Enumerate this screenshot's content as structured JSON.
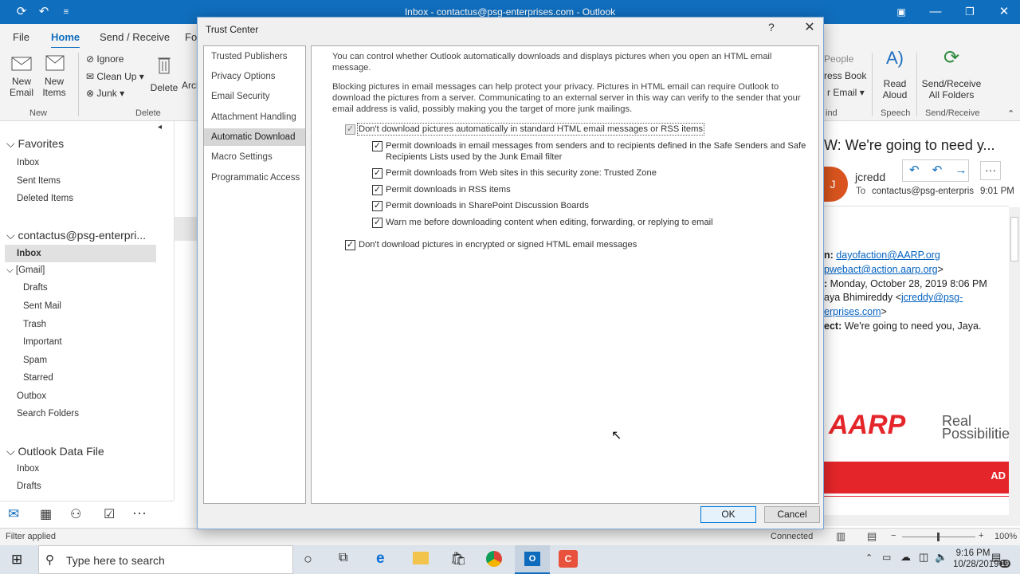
{
  "window": {
    "title": "Inbox - contactus@psg-enterprises.com  -  Outlook"
  },
  "ribbon": {
    "tabs": [
      "File",
      "Home",
      "Send / Receive",
      "Fo"
    ],
    "new_email": "New\nEmail",
    "new_email_l1": "New",
    "new_email_l2": "Email",
    "new_items_l1": "New",
    "new_items_l2": "Items",
    "ignore": "Ignore",
    "clean_up": "Clean Up",
    "junk": "Junk",
    "delete": "Delete",
    "archive": "Arch",
    "group_new": "New",
    "group_delete": "Delete",
    "people": "People",
    "address_book": "ress Book",
    "filter_email": "r Email",
    "group_find": "ind",
    "read_aloud_l1": "Read",
    "read_aloud_l2": "Aloud",
    "group_speech": "Speech",
    "send_receive_l1": "Send/Receive",
    "send_receive_l2": "All Folders",
    "group_send_receive": "Send/Receive"
  },
  "nav": {
    "favorites": "Favorites",
    "fav_items": [
      "Inbox",
      "Sent Items",
      "Deleted Items"
    ],
    "account": "contactus@psg-enterpri...",
    "inbox": "Inbox",
    "gmail": "[Gmail]",
    "gmail_items": [
      "Drafts",
      "Sent Mail",
      "Trash",
      "Important",
      "Spam",
      "Starred"
    ],
    "outbox": "Outbox",
    "search_folders": "Search Folders",
    "data_file": "Outlook Data File",
    "data_items": [
      "Inbox",
      "Drafts"
    ]
  },
  "status": {
    "left": "Filter applied",
    "connected": "Connected",
    "zoom": "100%"
  },
  "reading": {
    "subject": "W: We're going to need y...",
    "avatar_letter": "J",
    "sender": "jcredd",
    "to_label": "To",
    "to_value": "contactus@psg-enterpris",
    "time": "9:01 PM",
    "from_label": "n:",
    "from_value": "dayofaction@AARP.org",
    "reply_value": "pwebact@action.aarp.org",
    "sent_label": ":",
    "sent_value": "Monday, October 28, 2019 8:06 PM",
    "to2_prefix": "aya Bhimireddy <",
    "to2_link": "jcreddy@psg-",
    "to2_link2": "erprises.com",
    "subj_label": "ect:",
    "subj_value": "We're going to need you, Jaya.",
    "aarp": "AARP",
    "aarp_tag1": "Real",
    "aarp_tag2": "Possibilitie",
    "banner_text": "AD"
  },
  "dialog": {
    "title": "Trust Center",
    "help": "?",
    "nav": [
      "Trusted Publishers",
      "Privacy Options",
      "Email Security",
      "Attachment Handling",
      "Automatic Download",
      "Macro Settings",
      "Programmatic Access"
    ],
    "selected": "Automatic Download",
    "intro1": "You can control whether Outlook automatically downloads and displays pictures when you open an HTML email message.",
    "intro2": "Blocking pictures in email messages can help protect your privacy. Pictures in HTML email can require Outlook to download the pictures from a server. Communicating to an external server in this way can verify to the sender that your email address is valid, possibly making you the target of more junk mailings.",
    "opt_main": "Don't download pictures automatically in standard HTML email messages or RSS items",
    "opt_safe_senders": "Permit downloads in email messages from senders and to recipients defined in the Safe Senders and Safe Recipients Lists used by the Junk Email filter",
    "opt_trusted_zone": "Permit downloads from Web sites in this security zone: Trusted Zone",
    "opt_rss": "Permit downloads in RSS items",
    "opt_sharepoint": "Permit downloads in SharePoint Discussion Boards",
    "opt_warn": "Warn me before downloading content when editing, forwarding, or replying to email",
    "opt_encrypted": "Don't download pictures in encrypted or signed HTML email messages",
    "ok": "OK",
    "cancel": "Cancel"
  },
  "taskbar": {
    "search_placeholder": "Type here to search",
    "time": "9:16 PM",
    "date": "10/28/2019",
    "notif_count": "19"
  }
}
